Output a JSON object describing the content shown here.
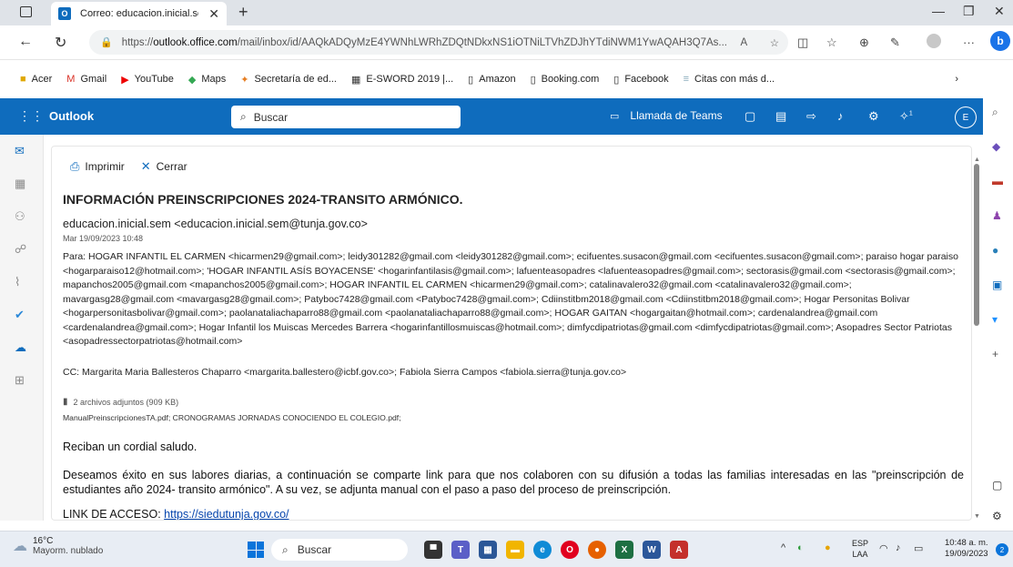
{
  "browser": {
    "tab_title": "Correo: educacion.inicial.se",
    "url_prefix": "https://",
    "url_host": "outlook.office.com",
    "url_path": "/mail/inbox/id/AAQkADQyMzE4YWNhLWRhZDQtNDkxNS1iOTNiLTVhZDJhYTdiNWM1YwAQAH3Q7As...",
    "favorites": [
      "Acer",
      "Gmail",
      "YouTube",
      "Maps",
      "Secretaría de ed...",
      "E-SWORD 2019 |...",
      "Amazon",
      "Booking.com",
      "Facebook",
      "Citas con más d..."
    ]
  },
  "outlook": {
    "brand": "Outlook",
    "search_placeholder": "Buscar",
    "teams_label": "Llamada de Teams",
    "avatar_initial": "E",
    "notification_count": "1"
  },
  "message": {
    "print_label": "Imprimir",
    "close_label": "Cerrar",
    "subject": "INFORMACIÓN PREINSCRIPCIONES 2024-TRANSITO ARMÓNICO.",
    "from": "educacion.inicial.sem <educacion.inicial.sem@tunja.gov.co>",
    "date": "Mar 19/09/2023 10:48",
    "to": "Para:  HOGAR INFANTIL EL CARMEN <hicarmen29@gmail.com>;  leidy301282@gmail.com <leidy301282@gmail.com>;  ecifuentes.susacon@gmail.com <ecifuentes.susacon@gmail.com>;  paraiso hogar paraiso <hogarparaiso12@hotmail.com>;  'HOGAR INFANTIL ASÍS BOYACENSE' <hogarinfantilasis@gmail.com>;  lafuenteasopadres <lafuenteasopadres@gmail.com>;  sectorasis@gmail.com <sectorasis@gmail.com>;  mapanchos2005@gmail.com <mapanchos2005@gmail.com>;  HOGAR INFANTIL EL CARMEN <hicarmen29@gmail.com>;  catalinavalero32@gmail.com <catalinavalero32@gmail.com>;  mavargasg28@gmail.com <mavargasg28@gmail.com>;  Patyboc7428@gmail.com <Patyboc7428@gmail.com>;  Cdiinstitbm2018@gmail.com <Cdiinstitbm2018@gmail.com>;  Hogar Personitas Bolivar <hogarpersonitasbolivar@gmail.com>;  paolanataliachaparro88@gmail.com <paolanataliachaparro88@gmail.com>;  HOGAR GAITAN <hogargaitan@hotmail.com>;  cardenalandrea@gmail.com <cardenalandrea@gmail.com>;  Hogar Infantil los Muiscas Mercedes Barrera <hogarinfantillosmuiscas@hotmail.com>;  dimfycdipatriotas@gmail.com <dimfycdipatriotas@gmail.com>;  Asopadres Sector Patriotas <asopadressectorpatriotas@hotmail.com>",
    "cc": "CC:  Margarita Maria Ballesteros Chaparro <margarita.ballestero@icbf.gov.co>;  Fabiola Sierra Campos <fabiola.sierra@tunja.gov.co>",
    "attachments_count": "2 archivos adjuntos (909 KB)",
    "attachments_files": "ManualPreinscripcionesTA.pdf; CRONOGRAMAS JORNADAS CONOCIENDO EL COLEGIO.pdf;",
    "greeting": "Reciban un cordial saludo.",
    "paragraph": "Deseamos éxito en  sus  labores diarias,  a continuación  se comparte link para  que  nos colaboren con su difusión a   todas  las  familias  interesadas  en  las \"preinscripción de estudiantes  año 2024- transito armónico\". A su vez, se adjunta manual  con el paso a paso del proceso de  preinscripción.",
    "link_label": "LINK DE ACCESO: ",
    "link_url": "https://siedutunja.gov.co/"
  },
  "taskbar": {
    "temp": "16°C",
    "weather": "Mayorm. nublado",
    "search_placeholder": "Buscar",
    "lang_line1": "ESP",
    "lang_line2": "LAA",
    "time": "10:48 a. m.",
    "date": "19/09/2023",
    "notif_count": "2"
  },
  "colors": {
    "outlook_blue": "#0f6cbd",
    "link": "#0645ad"
  }
}
